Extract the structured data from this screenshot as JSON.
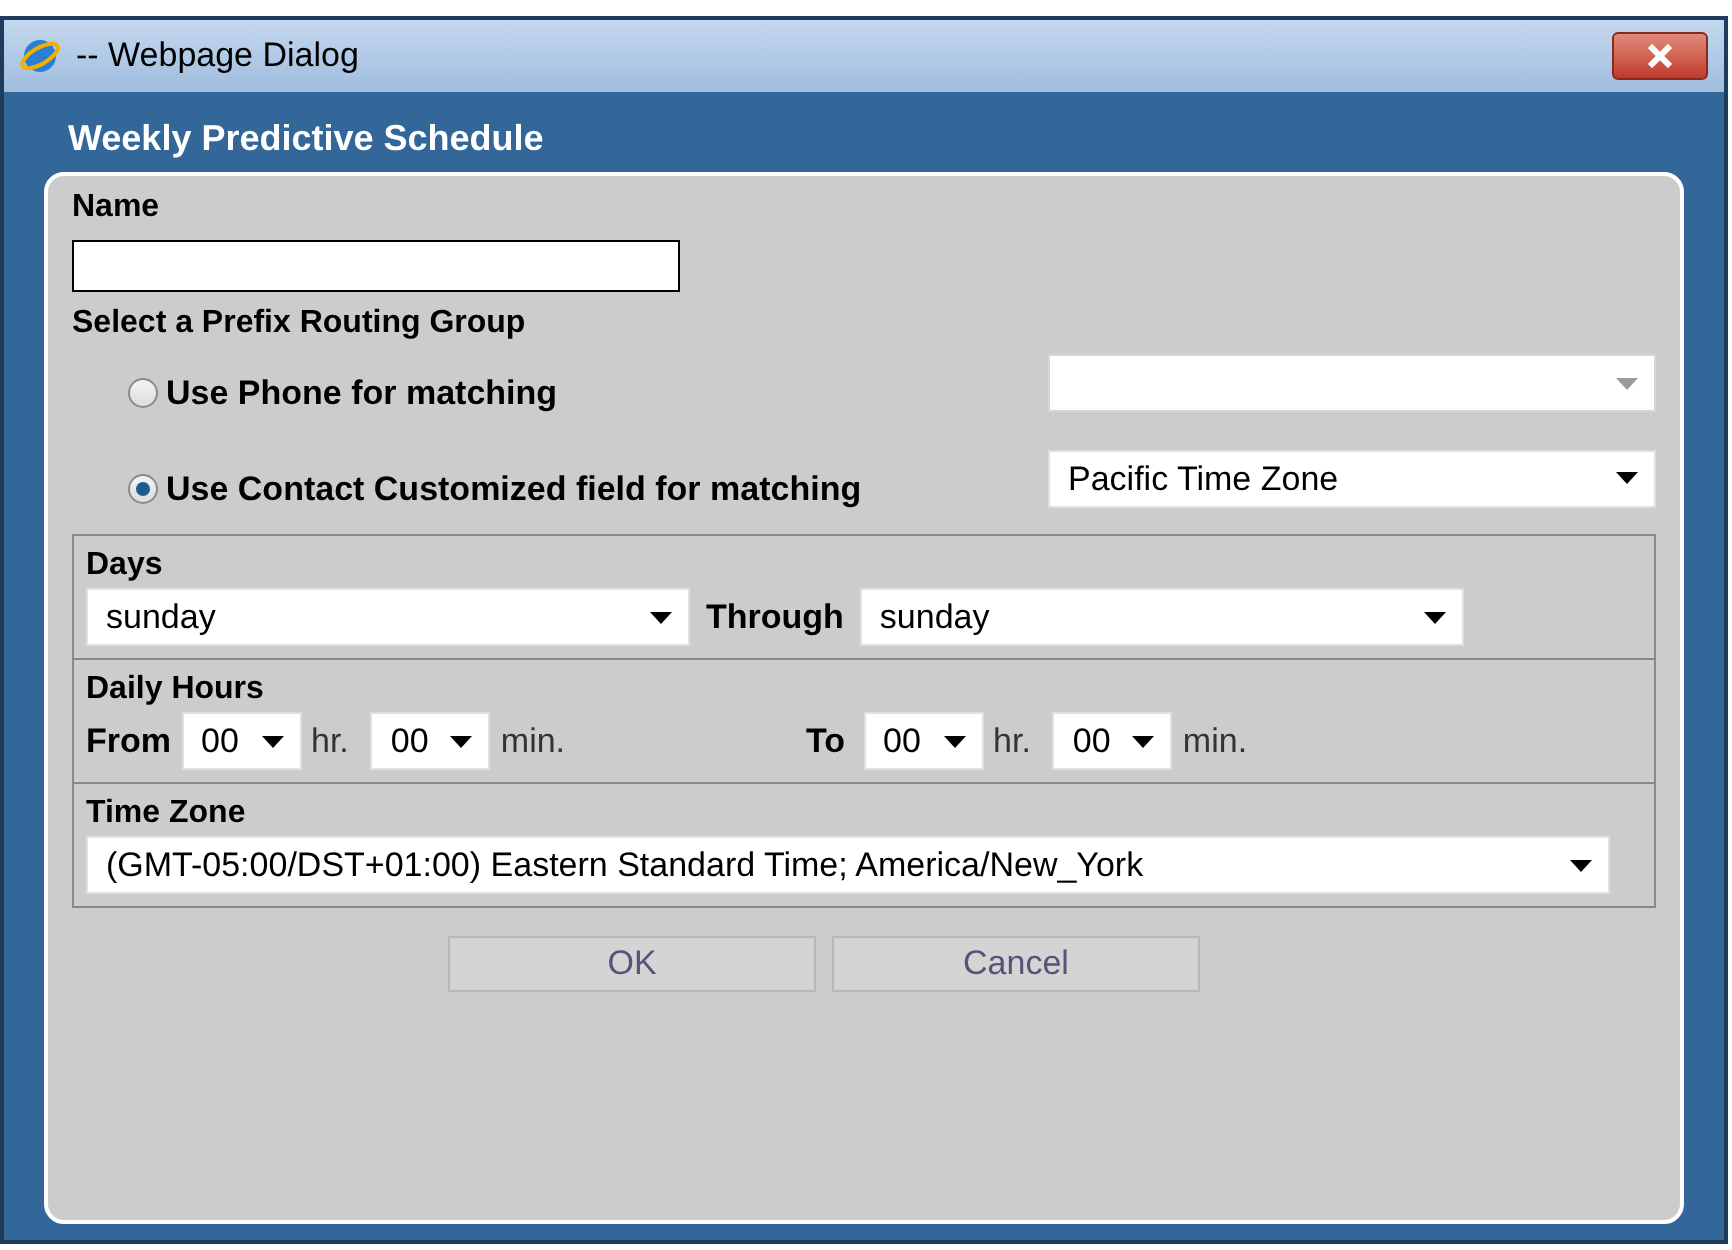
{
  "window": {
    "title": "-- Webpage Dialog"
  },
  "heading": "Weekly Predictive Schedule",
  "name": {
    "label": "Name"
  },
  "routing": {
    "label": "Select a Prefix Routing Group",
    "options": [
      {
        "label": "Use Phone for matching",
        "selected": false,
        "select": {
          "disabled": true
        }
      },
      {
        "label": "Use Contact Customized field for matching",
        "selected": true,
        "select": {
          "value": "Pacific Time Zone",
          "disabled": false
        }
      }
    ]
  },
  "days": {
    "label": "Days",
    "from": "sunday",
    "through_label": "Through",
    "to": "sunday"
  },
  "daily_hours": {
    "label": "Daily Hours",
    "groups": [
      {
        "label": "From",
        "hour": "00",
        "hour_unit": "hr.",
        "minute": "00",
        "minute_unit": "min."
      },
      {
        "label": "To",
        "hour": "00",
        "hour_unit": "hr.",
        "minute": "00",
        "minute_unit": "min."
      }
    ]
  },
  "time_zone": {
    "label": "Time Zone",
    "value": "(GMT-05:00/DST+01:00) Eastern Standard Time; America/New_York"
  },
  "buttons": [
    {
      "label": "OK"
    },
    {
      "label": "Cancel"
    }
  ]
}
